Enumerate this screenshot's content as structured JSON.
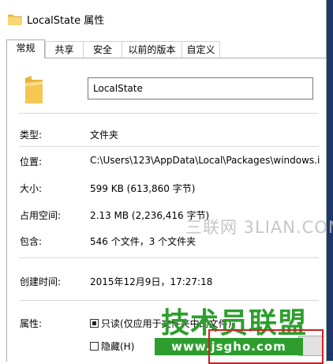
{
  "window": {
    "title": "LocalState 属性"
  },
  "tabs": [
    {
      "label": "常规",
      "active": true
    },
    {
      "label": "共享",
      "active": false
    },
    {
      "label": "安全",
      "active": false
    },
    {
      "label": "以前的版本",
      "active": false
    },
    {
      "label": "自定义",
      "active": false
    }
  ],
  "general": {
    "name_value": "LocalState",
    "type_label": "类型:",
    "type_value": "文件夹",
    "location_label": "位置:",
    "location_value": "C:\\Users\\123\\AppData\\Local\\Packages\\windows.i",
    "size_label": "大小:",
    "size_value": "599 KB (613,860 字节)",
    "disk_label": "占用空间:",
    "disk_value": "2.13 MB (2,236,416 字节)",
    "contains_label": "包含:",
    "contains_value": "546 个文件，3 个文件夹",
    "created_label": "创建时间:",
    "created_value": "2015年12月9日，17:27:18",
    "attributes_label": "属性:",
    "readonly_label": "只读(仅应用于文件夹中的文件)",
    "readonly_checked": true,
    "hidden_label": "隐藏(H)",
    "hidden_checked": false
  },
  "watermarks": {
    "top_text": "三联网 3LIAN.COM",
    "logo_text": "技术员联盟",
    "logo_url": "www.jsgho.com"
  },
  "colors": {
    "folder": "#f4c752",
    "logo_green": "#2d9e2d",
    "highlight_red": "#d02020"
  }
}
